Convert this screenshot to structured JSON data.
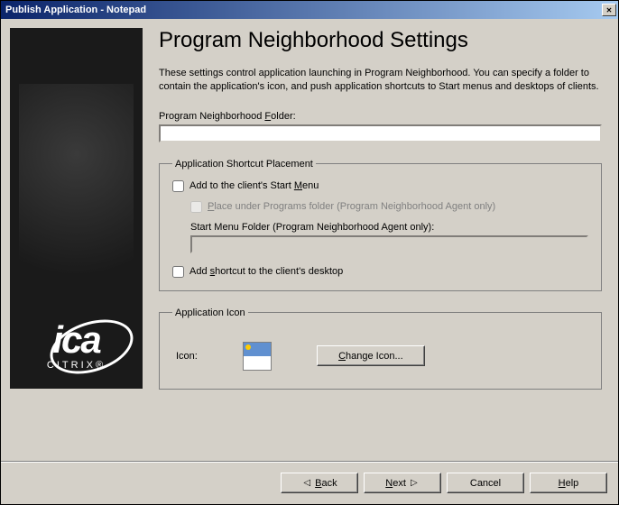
{
  "window": {
    "title": "Publish Application - Notepad"
  },
  "page": {
    "heading": "Program Neighborhood Settings",
    "description": "These settings control application launching in Program Neighborhood.  You can specify a folder to contain the application's icon, and push application shortcuts to Start menus and desktops of clients.",
    "folder_label_pre": "Program Neighborhood ",
    "folder_label_u": "F",
    "folder_label_post": "older:",
    "folder_value": ""
  },
  "shortcut_group": {
    "legend": "Application Shortcut Placement",
    "add_start_pre": "Add to the client's Start ",
    "add_start_u": "M",
    "add_start_post": "enu",
    "place_under_u": "P",
    "place_under_post": "lace under Programs folder (Program Neighborhood Agent only)",
    "start_folder_label": "Start Menu Folder (Program Neighborhood Agent only):",
    "start_folder_value": "",
    "add_desktop_pre": "Add ",
    "add_desktop_u": "s",
    "add_desktop_post": "hortcut to the client's desktop"
  },
  "icon_group": {
    "legend": "Application Icon",
    "icon_label": "Icon:",
    "change_btn_u": "C",
    "change_btn_post": "hange Icon..."
  },
  "footer": {
    "back_u": "B",
    "back_post": "ack",
    "next_u": "N",
    "next_post": "ext",
    "cancel": "Cancel",
    "help_u": "H",
    "help_post": "elp"
  },
  "brand": {
    "ica": "ica",
    "citrix": "CITRIX",
    "reg": "®"
  }
}
